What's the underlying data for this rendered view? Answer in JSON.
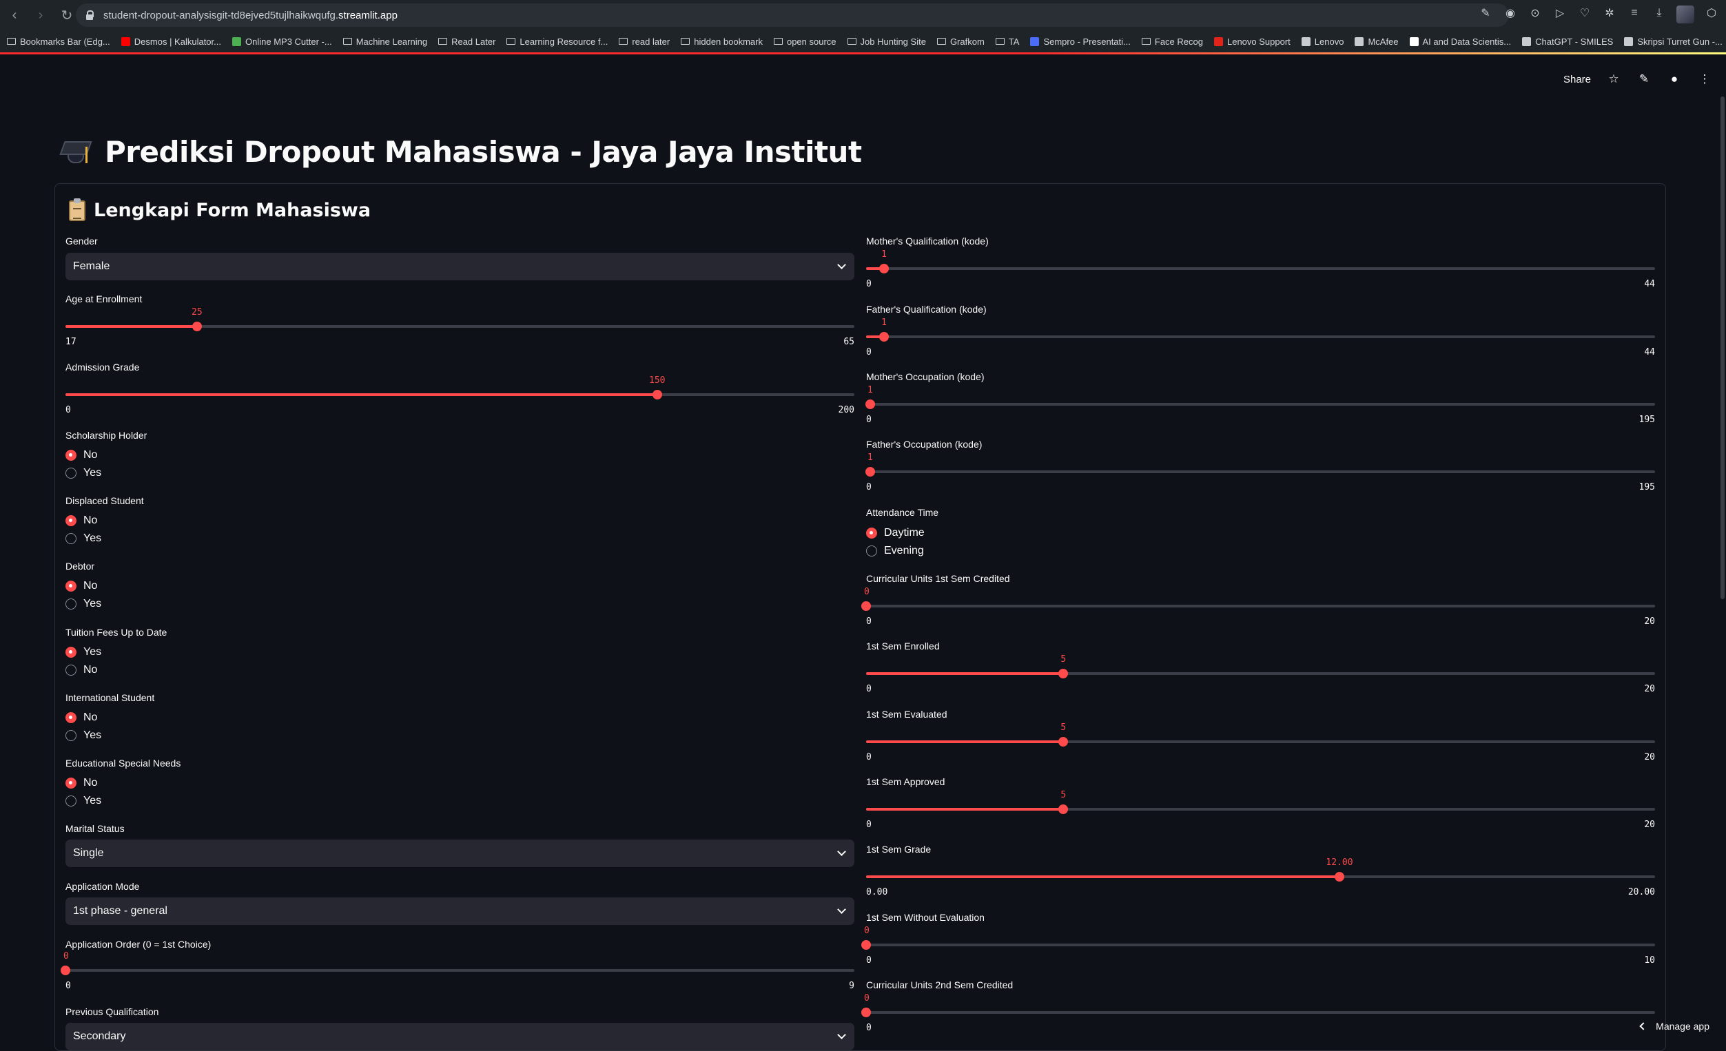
{
  "browser": {
    "url_path": "student-dropout-analysisgit-td8ejved5tujlhaikwqufg.",
    "url_domain": "streamlit.app",
    "bookmarks": [
      {
        "label": "Bookmarks Bar (Edg...",
        "kind": "folder"
      },
      {
        "label": "Desmos | Kalkulator...",
        "kind": "favicon",
        "color": "#ff0000"
      },
      {
        "label": "Online MP3 Cutter -...",
        "kind": "favicon",
        "color": "#4caf50"
      },
      {
        "label": "Machine Learning",
        "kind": "folder"
      },
      {
        "label": "Read Later",
        "kind": "folder"
      },
      {
        "label": "Learning Resource f...",
        "kind": "folder"
      },
      {
        "label": "read later",
        "kind": "folder"
      },
      {
        "label": "hidden bookmark",
        "kind": "folder"
      },
      {
        "label": "open source",
        "kind": "folder"
      },
      {
        "label": "Job Hunting Site",
        "kind": "folder"
      },
      {
        "label": "Grafkom",
        "kind": "folder"
      },
      {
        "label": "TA",
        "kind": "folder"
      },
      {
        "label": "Sempro - Presentati...",
        "kind": "favicon",
        "color": "#4a6cf7"
      },
      {
        "label": "Face Recog",
        "kind": "folder"
      },
      {
        "label": "Lenovo Support",
        "kind": "favicon",
        "color": "#e2231a"
      },
      {
        "label": "Lenovo",
        "kind": "favicon",
        "color": "#c8ccd0"
      },
      {
        "label": "McAfee",
        "kind": "favicon",
        "color": "#c8ccd0"
      },
      {
        "label": "AI and Data Scientis...",
        "kind": "favicon",
        "color": "#ffffff"
      },
      {
        "label": "ChatGPT - SMILES",
        "kind": "favicon",
        "color": "#c8ccd0"
      },
      {
        "label": "Skripsi Turret Gun -...",
        "kind": "favicon",
        "color": "#c8ccd0"
      }
    ]
  },
  "header": {
    "share_label": "Share"
  },
  "page": {
    "title": "Prediksi Dropout Mahasiswa - Jaya Jaya Institut",
    "form_title": "Lengkapi Form Mahasiswa"
  },
  "left": {
    "gender": {
      "label": "Gender",
      "value": "Female"
    },
    "age": {
      "label": "Age at Enrollment",
      "value": "25",
      "min": "17",
      "max": "65"
    },
    "admission": {
      "label": "Admission Grade",
      "value": "150",
      "min": "0",
      "max": "200"
    },
    "scholarship": {
      "label": "Scholarship Holder",
      "opt1": "No",
      "opt2": "Yes"
    },
    "displaced": {
      "label": "Displaced Student",
      "opt1": "No",
      "opt2": "Yes"
    },
    "debtor": {
      "label": "Debtor",
      "opt1": "No",
      "opt2": "Yes"
    },
    "tuition": {
      "label": "Tuition Fees Up to Date",
      "opt1": "Yes",
      "opt2": "No"
    },
    "international": {
      "label": "International Student",
      "opt1": "No",
      "opt2": "Yes"
    },
    "special_needs": {
      "label": "Educational Special Needs",
      "opt1": "No",
      "opt2": "Yes"
    },
    "marital": {
      "label": "Marital Status",
      "value": "Single"
    },
    "app_mode": {
      "label": "Application Mode",
      "value": "1st phase - general"
    },
    "app_order": {
      "label": "Application Order (0 = 1st Choice)",
      "value": "0",
      "min": "0",
      "max": "9"
    },
    "prev_qual": {
      "label": "Previous Qualification",
      "value": "Secondary"
    }
  },
  "right": {
    "mother_qual": {
      "label": "Mother's Qualification (kode)",
      "value": "1",
      "min": "0",
      "max": "44"
    },
    "father_qual": {
      "label": "Father's Qualification (kode)",
      "value": "1",
      "min": "0",
      "max": "44"
    },
    "mother_occ": {
      "label": "Mother's Occupation (kode)",
      "value": "1",
      "min": "0",
      "max": "195"
    },
    "father_occ": {
      "label": "Father's Occupation (kode)",
      "value": "1",
      "min": "0",
      "max": "195"
    },
    "attendance": {
      "label": "Attendance Time",
      "opt1": "Daytime",
      "opt2": "Evening"
    },
    "cu1_credited": {
      "label": "Curricular Units 1st Sem Credited",
      "value": "0",
      "min": "0",
      "max": "20"
    },
    "s1_enrolled": {
      "label": "1st Sem Enrolled",
      "value": "5",
      "min": "0",
      "max": "20"
    },
    "s1_evaluated": {
      "label": "1st Sem Evaluated",
      "value": "5",
      "min": "0",
      "max": "20"
    },
    "s1_approved": {
      "label": "1st Sem Approved",
      "value": "5",
      "min": "0",
      "max": "20"
    },
    "s1_grade": {
      "label": "1st Sem Grade",
      "value": "12.00",
      "min": "0.00",
      "max": "20.00"
    },
    "s1_no_eval": {
      "label": "1st Sem Without Evaluation",
      "value": "0",
      "min": "0",
      "max": "10"
    },
    "cu2_credited": {
      "label": "Curricular Units 2nd Sem Credited",
      "value": "0",
      "min": "0"
    }
  },
  "footer": {
    "manage_label": "Manage app"
  },
  "colors": {
    "accent": "#ff4b4b",
    "background": "#0e1117",
    "widget": "#262730"
  }
}
